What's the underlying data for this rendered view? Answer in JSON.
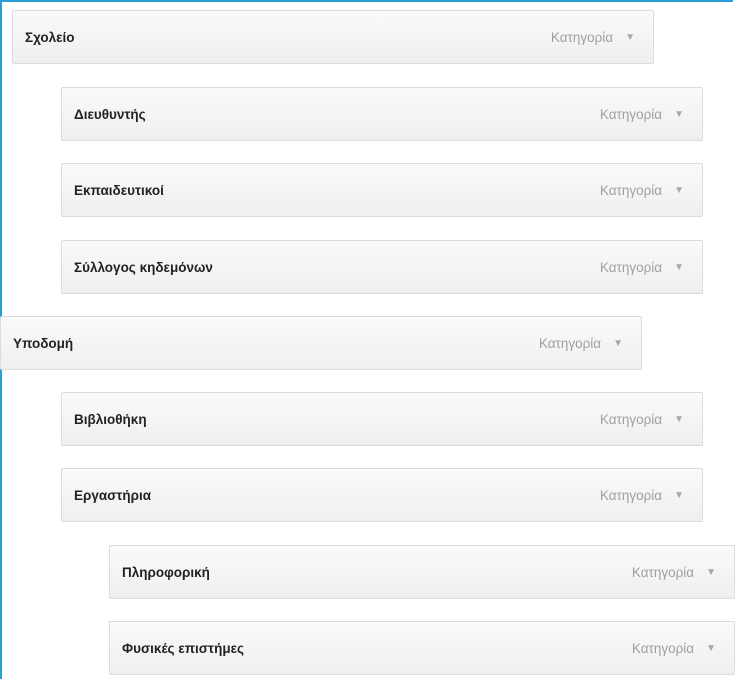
{
  "menu": {
    "items": [
      {
        "title": "Σχολείο",
        "type": "Κατηγορία",
        "depth": 0
      },
      {
        "title": "Διευθυντής",
        "type": "Κατηγορία",
        "depth": 1
      },
      {
        "title": "Εκπαιδευτικοί",
        "type": "Κατηγορία",
        "depth": 1
      },
      {
        "title": "Σύλλογος κηδεμόνων",
        "type": "Κατηγορία",
        "depth": 1
      },
      {
        "title": "Υποδομή",
        "type": "Κατηγορία",
        "depth": 0
      },
      {
        "title": "Βιβλιοθήκη",
        "type": "Κατηγορία",
        "depth": 1
      },
      {
        "title": "Εργαστήρια",
        "type": "Κατηγορία",
        "depth": 1
      },
      {
        "title": "Πληροφορική",
        "type": "Κατηγορία",
        "depth": 2
      },
      {
        "title": "Φυσικές επιστήμες",
        "type": "Κατηγορία",
        "depth": 2
      }
    ]
  },
  "icons": {
    "expand": "triangle-down"
  },
  "colors": {
    "frame_border": "#2a9fd6",
    "item_bg": "#f3f3f3",
    "item_border": "#dcdcdc",
    "title_text": "#222222",
    "type_text": "#a0a0a0"
  }
}
